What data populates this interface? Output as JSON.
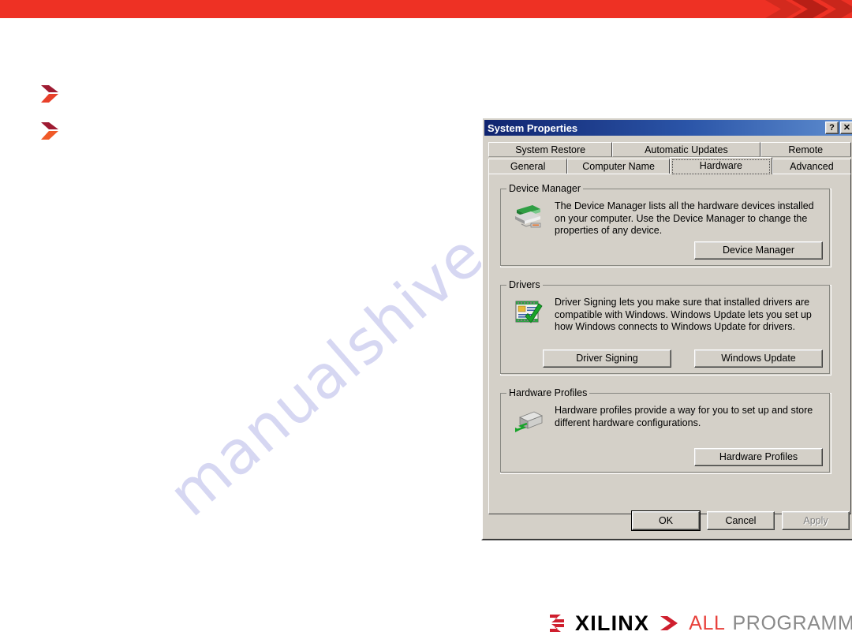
{
  "slide": {
    "watermark": "manualshive.com",
    "banner_color": "#ee3124",
    "bullets": [
      {
        "name": "bullet-chevron-1",
        "color_dark": "#9e1b32",
        "color_light": "#e8402a"
      },
      {
        "name": "bullet-chevron-2",
        "color_dark": "#9e1b32",
        "color_light": "#f05a28"
      }
    ],
    "footer": {
      "brand": "XILINX",
      "tagline_accent": "ALL",
      "tagline_rest": "PROGRAMMABLE.",
      "accent_color": "#e8403a",
      "rest_color": "#8a8a8a"
    }
  },
  "dialog": {
    "title": "System Properties",
    "title_buttons": {
      "help": "?",
      "close": "✕"
    },
    "tabs_row1": [
      {
        "label": "System Restore",
        "selected": false
      },
      {
        "label": "Automatic Updates",
        "selected": false
      },
      {
        "label": "Remote",
        "selected": false
      }
    ],
    "tabs_row2": [
      {
        "label": "General",
        "selected": false
      },
      {
        "label": "Computer Name",
        "selected": false
      },
      {
        "label": "Hardware",
        "selected": true
      },
      {
        "label": "Advanced",
        "selected": false
      }
    ],
    "groups": {
      "device_manager": {
        "legend": "Device Manager",
        "icon": "device-stack-icon",
        "description": "The Device Manager lists all the hardware devices installed on your computer. Use the Device Manager to change the properties of any device.",
        "button": {
          "label": "Device Manager",
          "accel": "D",
          "enabled": true
        }
      },
      "drivers": {
        "legend": "Drivers",
        "icon": "signed-certificate-icon",
        "description": "Driver Signing lets you make sure that installed drivers are compatible with Windows. Windows Update lets you set up how Windows connects to Windows Update for drivers.",
        "buttons": [
          {
            "label": "Driver Signing",
            "accel": "S",
            "enabled": true
          },
          {
            "label": "Windows Update",
            "accel": "W",
            "enabled": true
          }
        ]
      },
      "hardware_profiles": {
        "legend": "Hardware Profiles",
        "icon": "computer-profile-icon",
        "description": "Hardware profiles provide a way for you to set up and store different hardware configurations.",
        "button": {
          "label": "Hardware Profiles",
          "accel": "P",
          "enabled": true
        }
      }
    },
    "actions": [
      {
        "label": "OK",
        "enabled": true,
        "default": true
      },
      {
        "label": "Cancel",
        "enabled": true,
        "default": false
      },
      {
        "label": "Apply",
        "enabled": false,
        "default": false
      }
    ]
  }
}
